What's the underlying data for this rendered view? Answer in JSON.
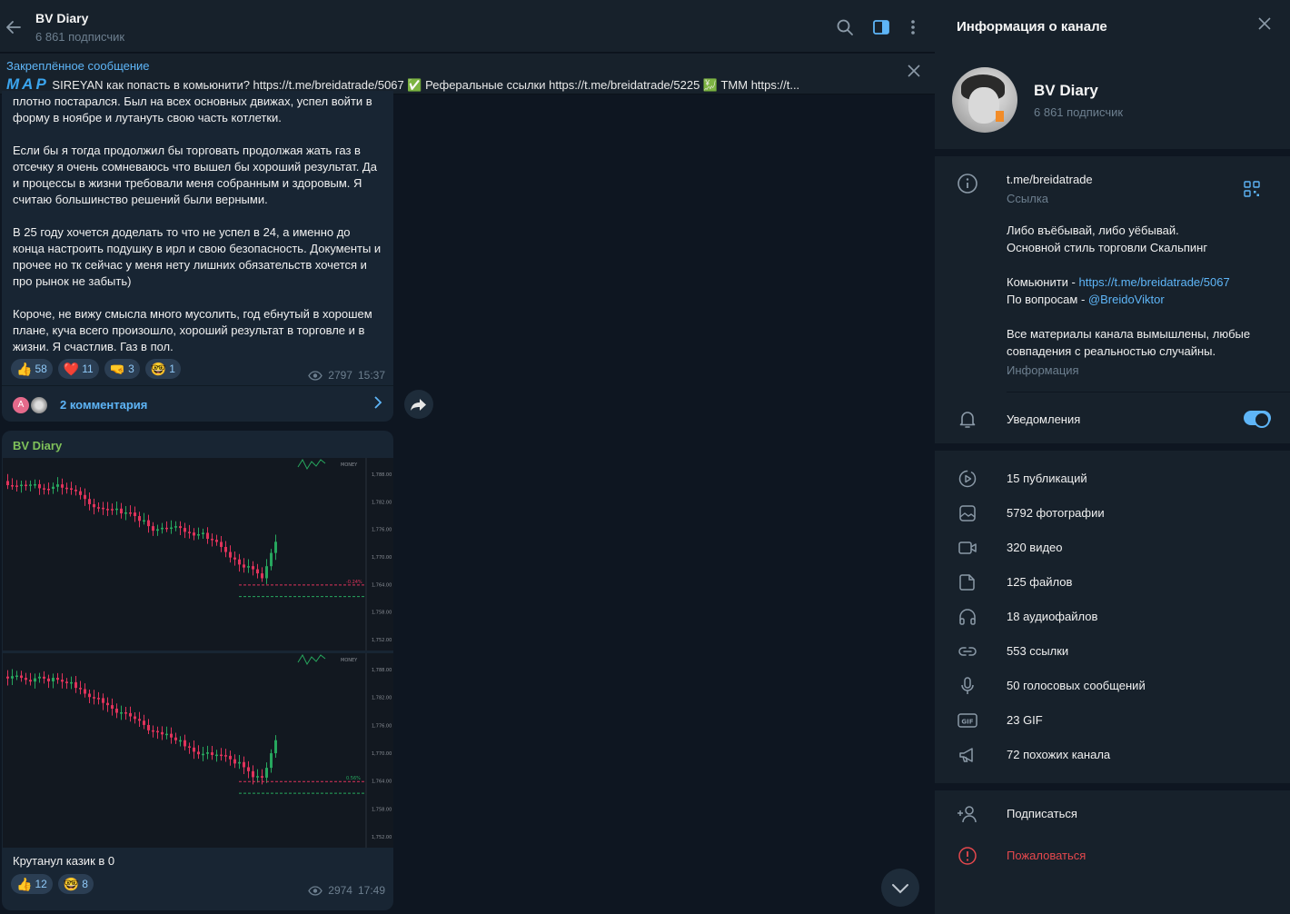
{
  "header": {
    "title": "BV Diary",
    "subtitle": "6 861 подписчик"
  },
  "pinned": {
    "label": "Закреплённое сообщение",
    "map": "MAP",
    "text": "SIREYAN как попасть в комьюнити? https://t.me/breidatrade/5067 ✅ Реферальные ссылки  https://t.me/breidatrade/5225 💹 TMM  https://t..."
  },
  "message1": {
    "paragraphs": [
      "плотно постарался. Был на всех основных движах, успел войти в форму в ноябре и лутануть свою часть котлетки.",
      "Если бы я тогда продолжил бы торговать продолжая жать газ в отсечку я очень сомневаюсь что вышел бы хороший результат. Да и процессы в жизни требовали меня собранным и здоровым. Я считаю большинство решений были верными.",
      "В 25 году хочется доделать то что не успел в 24, а именно до конца настроить подушку в ирл и свою безопасность. Документы и прочее но тк сейчас у меня нету лишних обязательств хочется и про рынок не забыть)",
      "Короче, не вижу смысла много мусолить, год ебнутый в хорошем плане, куча всего произошло, хороший результат в торговле и в жизни. Я счастлив. Газ в пол."
    ],
    "reactions": [
      {
        "emoji": "👍",
        "count": "58"
      },
      {
        "emoji": "❤️",
        "count": "11"
      },
      {
        "emoji": "🤜",
        "count": "3"
      },
      {
        "emoji": "🤓",
        "count": "1"
      }
    ],
    "views": "2797",
    "time": "15:37",
    "comments_avatar_letter": "A",
    "comments": "2 комментария"
  },
  "message2": {
    "author": "BV Diary",
    "caption": "Крутанул казик в 0",
    "reactions": [
      {
        "emoji": "👍",
        "count": "12"
      },
      {
        "emoji": "🤓",
        "count": "8"
      }
    ],
    "views": "2974",
    "time": "17:49",
    "chart1_price_labels": [
      "1,788.00",
      "1,782.00",
      "1,776.00",
      "1,770.00",
      "1,764.00",
      "1,758.00",
      "1,752.00"
    ],
    "chart1_pct": "-0.24%",
    "chart2_price_labels": [
      "1,788.00",
      "1,782.00",
      "1,776.00",
      "1,770.00",
      "1,764.00",
      "1,758.00",
      "1,752.00"
    ],
    "chart2_pct": "0.56%",
    "money_label": "MONEY"
  },
  "panel": {
    "title": "Информация о канале",
    "name": "BV Diary",
    "subscribers": "6 861 подписчик",
    "link": "t.me/breidatrade",
    "link_label": "Ссылка",
    "desc1": "Либо въёбывай, либо уёбывай.",
    "desc2": "Основной стиль торговли Скальпинг",
    "community_prefix": "Комьюнити - ",
    "community_link": "https://t.me/breidatrade/5067",
    "questions_prefix": "По вопросам - ",
    "questions_link": "@BreidoViktor",
    "disclaimer1": "Все материалы канала вымышлены, любые",
    "disclaimer2": "совпадения с реальностью случайны.",
    "info_label": "Информация",
    "notifications": "Уведомления",
    "media": [
      {
        "icon": "play-circle-icon",
        "label": "15 публикаций"
      },
      {
        "icon": "photo-icon",
        "label": "5792 фотографии"
      },
      {
        "icon": "video-icon",
        "label": "320 видео"
      },
      {
        "icon": "file-icon",
        "label": "125 файлов"
      },
      {
        "icon": "headphones-icon",
        "label": "18 аудиофайлов"
      },
      {
        "icon": "link-icon",
        "label": "553 ссылки"
      },
      {
        "icon": "microphone-icon",
        "label": "50 голосовых сообщений"
      },
      {
        "icon": "gif-icon",
        "label": "23 GIF"
      },
      {
        "icon": "megaphone-icon",
        "label": "72 похожих канала"
      }
    ],
    "subscribe": "Подписаться",
    "report": "Пожаловаться"
  }
}
